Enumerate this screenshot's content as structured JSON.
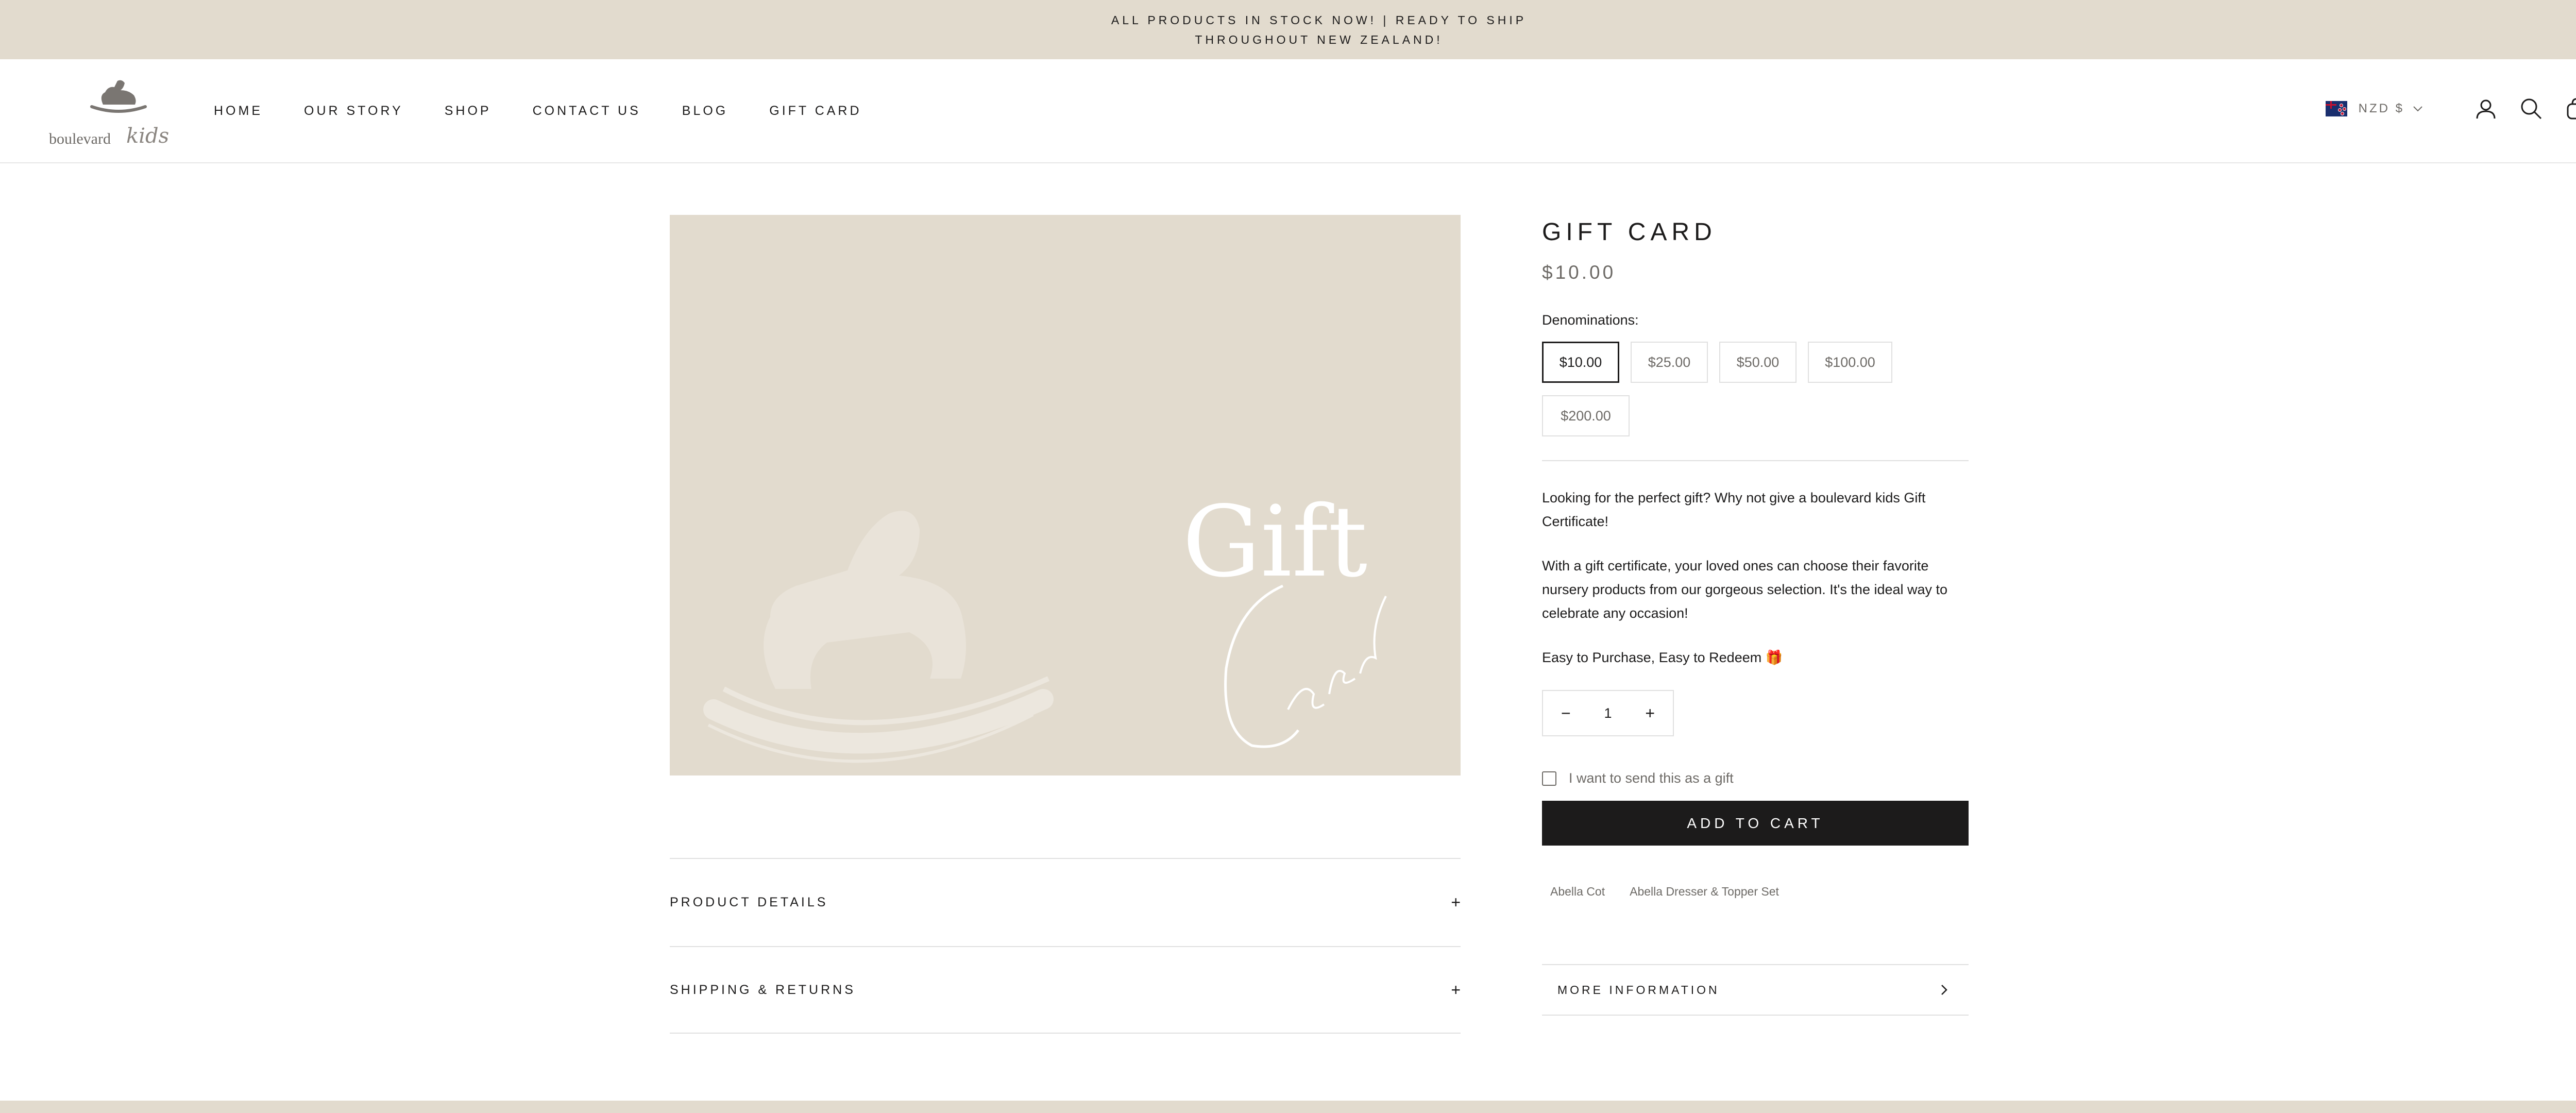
{
  "announcement": {
    "text": "ALL PRODUCTS IN STOCK NOW! | READY TO SHIP THROUGHOUT NEW ZEALAND!"
  },
  "header": {
    "logo": {
      "text": "boulevard",
      "script": "kids"
    },
    "nav": [
      "HOME",
      "OUR STORY",
      "SHOP",
      "CONTACT US",
      "BLOG",
      "GIFT CARD"
    ],
    "currency": "NZD $",
    "icons": [
      "nz-flag-icon",
      "chevron-down-icon",
      "account-icon",
      "search-icon",
      "cart-icon"
    ]
  },
  "gallery": {
    "gift_word": "Gift",
    "card_word": "Card"
  },
  "accordions": [
    "PRODUCT DETAILS",
    "SHIPPING & RETURNS"
  ],
  "product": {
    "title": "GIFT CARD",
    "price": "$10.00",
    "denominations_label": "Denominations:",
    "denominations": [
      "$10.00",
      "$25.00",
      "$50.00",
      "$100.00",
      "$200.00"
    ],
    "selected_denomination": "$10.00",
    "description": [
      "Looking for the perfect gift?  Why not give a boulevard kids Gift Certificate!",
      "With a gift certificate, your loved ones can choose their favorite nursery products from our gorgeous selection.  It's the ideal way to celebrate any occasion!",
      "Easy to Purchase, Easy to Redeem 🎁"
    ],
    "quantity": "1",
    "gift_checkbox_label": "I want to send this as a gift",
    "add_to_cart": "ADD TO CART",
    "related": [
      "Abella Cot",
      "Abella Dresser & Topper Set"
    ],
    "more_info": "MORE INFORMATION"
  },
  "colors": {
    "beige": "#e2dbce",
    "dark": "#1c1b1b",
    "muted": "#6d6a66"
  }
}
